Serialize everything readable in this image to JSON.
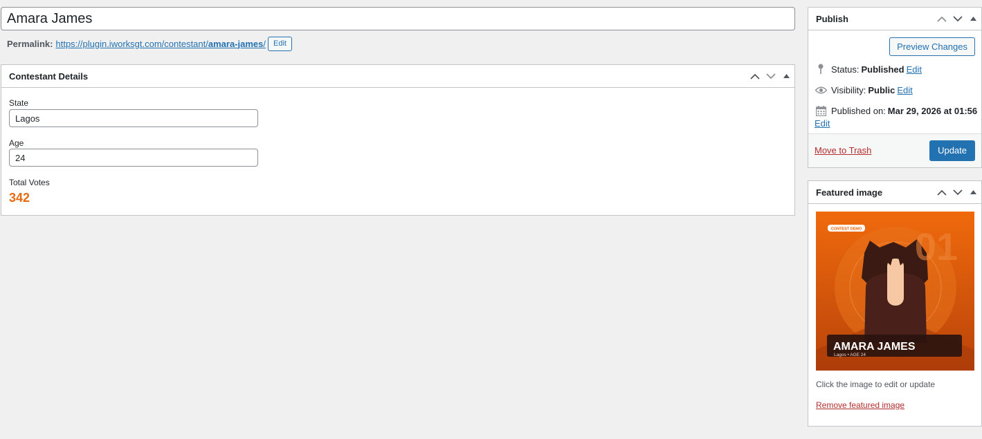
{
  "post": {
    "title": "Amara James",
    "permalink_label": "Permalink:",
    "permalink_base": "https://plugin.iworksgt.com/contestant/",
    "permalink_slug": "amara-james",
    "permalink_trailing": "/",
    "permalink_edit_label": "Edit"
  },
  "contestant_details": {
    "heading": "Contestant Details",
    "state_label": "State",
    "state_value": "Lagos",
    "age_label": "Age",
    "age_value": "24",
    "votes_label": "Total Votes",
    "votes_value": "342"
  },
  "publish": {
    "heading": "Publish",
    "preview_label": "Preview Changes",
    "status_label": "Status:",
    "status_value": "Published",
    "visibility_label": "Visibility:",
    "visibility_value": "Public",
    "published_label": "Published on:",
    "published_value": "Mar 29, 2026 at 01:56",
    "edit_label": "Edit",
    "trash_label": "Move to Trash",
    "update_label": "Update"
  },
  "featured_image": {
    "heading": "Featured image",
    "badge": "CONTEST DEMO",
    "number": "01",
    "name": "AMARA JAMES",
    "meta": "Lagos  •  AGE 24",
    "help_text": "Click the image to edit or update",
    "remove_label": "Remove featured image"
  },
  "colors": {
    "accent": "#2271b1",
    "votes": "#e66a12",
    "danger": "#b32d2e",
    "image_orange": "#e8660e"
  }
}
